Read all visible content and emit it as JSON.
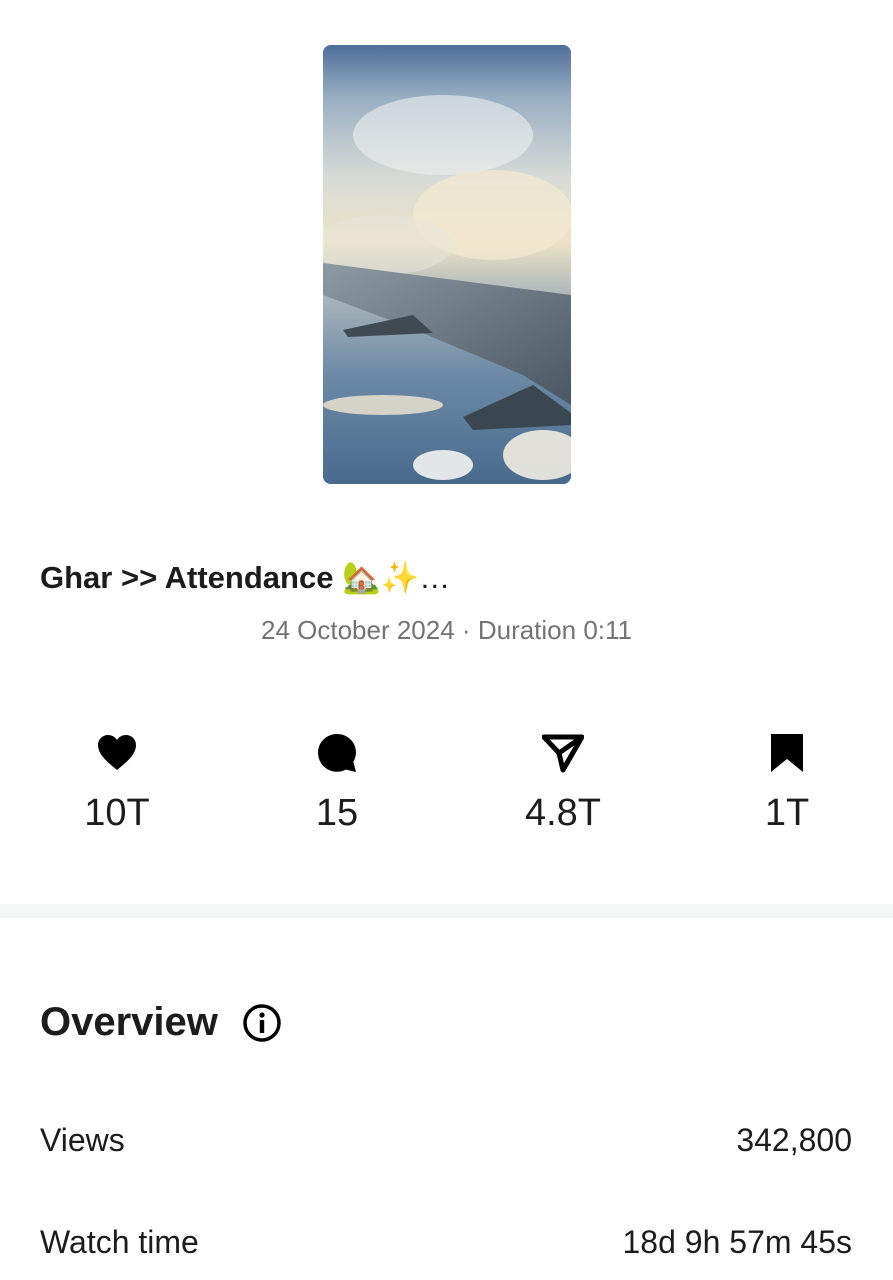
{
  "post": {
    "thumbnail_alt": "airplane-wing-over-clouds",
    "caption": "Ghar >> Attendance",
    "caption_emoji": "🏡✨…",
    "date": "24 October 2024",
    "separator": "·",
    "duration": "Duration 0:11"
  },
  "metrics": [
    {
      "icon": "heart-icon",
      "value": "10T"
    },
    {
      "icon": "comment-icon",
      "value": "15"
    },
    {
      "icon": "share-icon",
      "value": "4.8T"
    },
    {
      "icon": "bookmark-icon",
      "value": "1T"
    }
  ],
  "overview": {
    "title": "Overview",
    "info_icon": "info-icon",
    "rows": [
      {
        "label": "Views",
        "value": "342,800"
      },
      {
        "label": "Watch time",
        "value": "18d 9h 57m 45s"
      }
    ]
  }
}
